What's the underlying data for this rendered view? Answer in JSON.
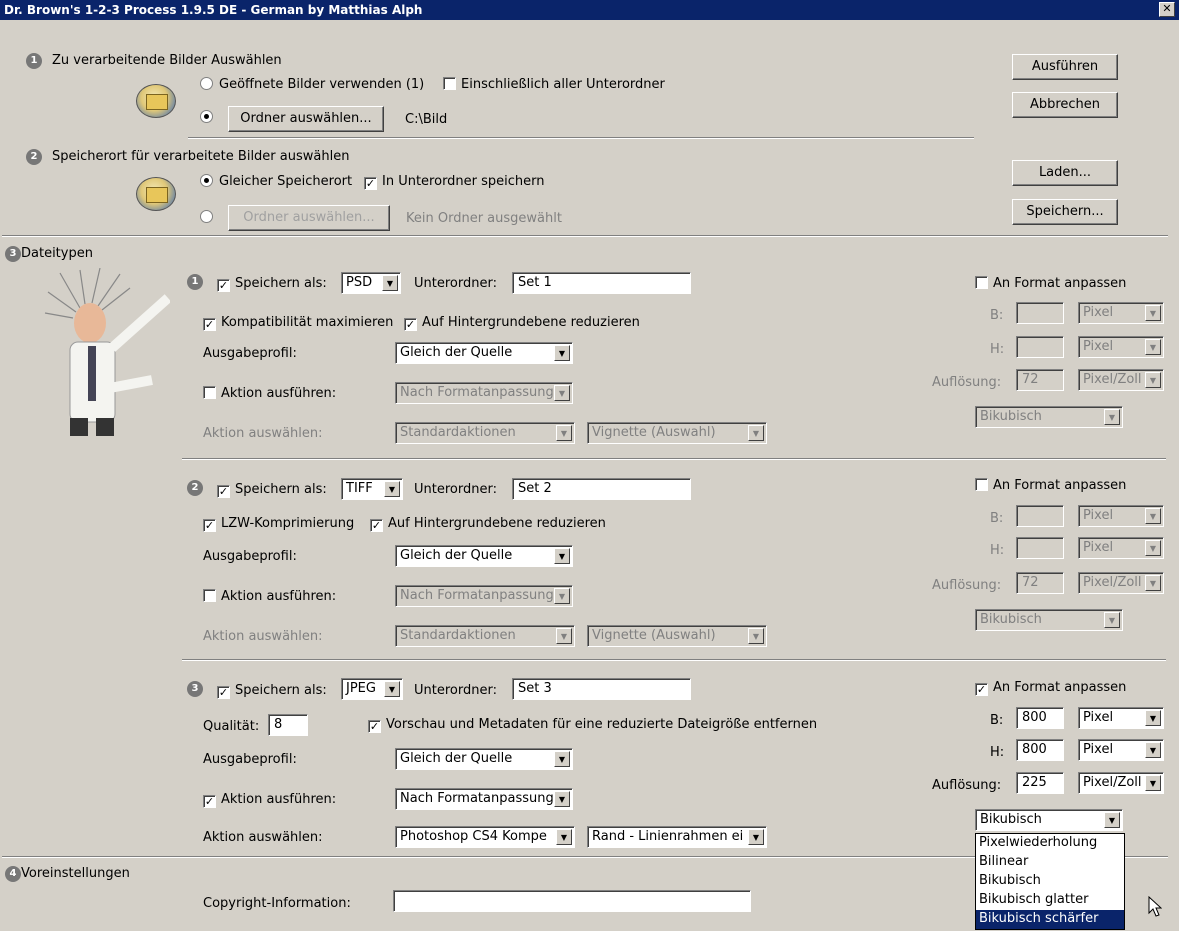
{
  "window": {
    "title": "Dr. Brown's 1-2-3 Process 1.9.5 DE - German by Matthias Alph",
    "close": "✕"
  },
  "buttons": {
    "run": "Ausführen",
    "cancel": "Abbrechen",
    "load": "Laden...",
    "save": "Speichern..."
  },
  "s1": {
    "num": "1",
    "title": "Zu verarbeitende Bilder Auswählen",
    "open_images": "Geöffnete Bilder verwenden (1)",
    "subfolders": "Einschließlich aller Unterordner",
    "folder_btn": "Ordner auswählen...",
    "folder_path": "C:\\Bild"
  },
  "s2": {
    "num": "2",
    "title": "Speicherort für verarbeitete Bilder auswählen",
    "same": "Gleicher Speicherort",
    "subfolder": "In Unterordner speichern",
    "folder_btn": "Ordner auswählen...",
    "no_folder": "Kein Ordner ausgewählt"
  },
  "s3": {
    "num": "3",
    "title": "Dateitypen"
  },
  "s4": {
    "num": "4",
    "title": "Voreinstellungen",
    "copyright_label": "Copyright-Information:",
    "copyright_value": ""
  },
  "labels": {
    "save_as": "Speichern als:",
    "subfolder": "Unterordner:",
    "profile": "Ausgabeprofil:",
    "run_action": "Aktion ausführen:",
    "choose_action": "Aktion auswählen:",
    "fit": "An Format anpassen",
    "b": "B:",
    "h": "H:",
    "res": "Auflösung:",
    "quality": "Qualität:"
  },
  "set1": {
    "num": "1",
    "format": "PSD",
    "folder": "Set 1",
    "opt1": "Kompatibilität maximieren",
    "opt2": "Auf Hintergrundebene reduzieren",
    "profile": "Gleich der Quelle",
    "action": "Nach Formatanpassung",
    "actionset": "Standardaktionen",
    "actionname": "Vignette (Auswahl)",
    "w": "",
    "h": "",
    "wu": "Pixel",
    "hu": "Pixel",
    "res": "72",
    "resu": "Pixel/Zoll",
    "interp": "Bikubisch"
  },
  "set2": {
    "num": "2",
    "format": "TIFF",
    "folder": "Set 2",
    "opt1": "LZW-Komprimierung",
    "opt2": "Auf Hintergrundebene reduzieren",
    "profile": "Gleich der Quelle",
    "action": "Nach Formatanpassung",
    "actionset": "Standardaktionen",
    "actionname": "Vignette (Auswahl)",
    "w": "",
    "h": "",
    "wu": "Pixel",
    "hu": "Pixel",
    "res": "72",
    "resu": "Pixel/Zoll",
    "interp": "Bikubisch"
  },
  "set3": {
    "num": "3",
    "format": "JPEG",
    "folder": "Set 3",
    "quality": "8",
    "opt": "Vorschau und Metadaten für eine reduzierte Dateigröße entfernen",
    "profile": "Gleich der Quelle",
    "action": "Nach Formatanpassung",
    "actionset": "Photoshop CS4 Kompe",
    "actionname": "Rand - Linienrahmen ei",
    "w": "800",
    "h": "800",
    "wu": "Pixel",
    "hu": "Pixel",
    "res": "225",
    "resu": "Pixel/Zoll",
    "interp": "Bikubisch"
  },
  "interp_options": [
    "Pixelwiederholung",
    "Bilinear",
    "Bikubisch",
    "Bikubisch glatter",
    "Bikubisch schärfer"
  ],
  "check": "✓",
  "arrow": "▼"
}
